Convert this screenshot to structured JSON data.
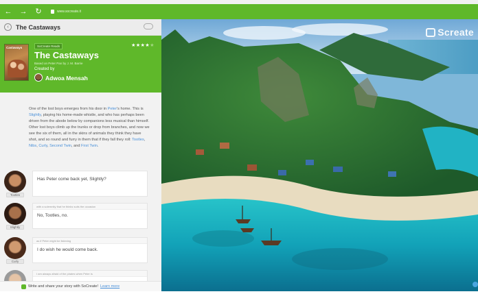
{
  "browser": {
    "url": "www.socreate.it",
    "back_glyph": "←",
    "forward_glyph": "→",
    "reload_glyph": "↻"
  },
  "panel": {
    "back_glyph": "‹",
    "title": "The Castaways"
  },
  "story": {
    "cover_title": "Castaways",
    "tag": "SoCreate Reads",
    "title": "The Castaways",
    "subtitle": "Based on Peter Pan by J. M. Barrie",
    "created_by_label": "Created by",
    "author": "Adwoa Mensah",
    "rating": {
      "value": 4,
      "max": 5,
      "filled_glyph": "★★★★",
      "empty_glyph": "★"
    }
  },
  "narration": {
    "p1": "One of the lost boys emerges from his door in ",
    "peter1": "Peter",
    "p2": "'s home. This is ",
    "slightly": "Slightly",
    "p3": ", playing his home-made whistle, and who has perhaps been driven from the abode below by companions less musical than himself. Other lost boys climb up the trunks or drop from branches, and now we see the six of them, all in the skins of animals they think they have shot, and so round and furry in them that if they fall they roll: ",
    "tootles": "Tootles",
    "sep1": ", ",
    "nibs": "Nibs",
    "sep2": ", ",
    "curly": "Curly",
    "sep3": ", ",
    "second_twin": "Second Twin",
    "and": ", and ",
    "first_twin": "First Twin",
    "end": "."
  },
  "dialogs": [
    {
      "character": "Tootles",
      "hint": "",
      "text": "Has Peter come back yet, Slightly?"
    },
    {
      "character": "Slightly",
      "hint": "with a solemnity that he thinks suits the occasion",
      "text": "No, Tootles, no."
    },
    {
      "character": "Curly",
      "hint": "as if Peter might be listening",
      "text": "I do wish he would come back."
    },
    {
      "character": "",
      "hint": "I am always afraid of the pirates when Peter is",
      "text": ""
    }
  ],
  "footer": {
    "text": "Write and share your story with SoCreate!",
    "link": "Learn more"
  },
  "scene": {
    "brand": "Screate",
    "alt": "tropical island bay with ships"
  },
  "colors": {
    "brand_green": "#5fb82a",
    "link_blue": "#4a90d9",
    "sea": "#1fb3c4"
  }
}
